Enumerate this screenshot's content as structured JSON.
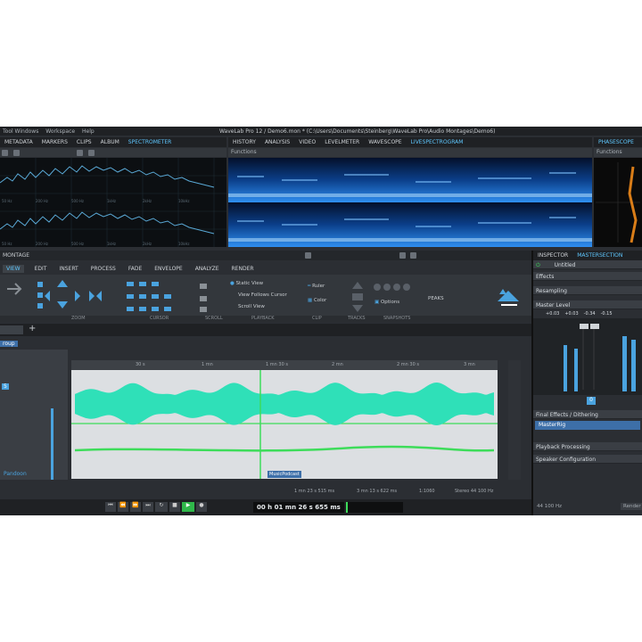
{
  "menu": {
    "items": [
      "Tool Windows",
      "Workspace",
      "Help"
    ],
    "title": "WaveLab Pro 12 / Demo6.mon * (C:\\Users\\Documents\\Steinberg\\WaveLab Pro\\Audio Montages\\Demo6)"
  },
  "left_tabs": [
    "METADATA",
    "MARKERS",
    "CLIPS",
    "ALBUM",
    "SPECTROMETER"
  ],
  "mid_tabs": [
    "HISTORY",
    "ANALYSIS",
    "VIDEO",
    "LEVELMETER",
    "WAVESCOPE",
    "LIVESPECTROGRAM"
  ],
  "right_tabs": [
    "PHASESCOPE"
  ],
  "functions_label": "Functions",
  "spectrum_ticks": [
    "50 Hz",
    "100 Hz",
    "200 Hz",
    "500 Hz",
    "1kHz",
    "2kHz",
    "5kHz",
    "10kHz",
    "20kHz"
  ],
  "montage_label": "MONTAGE",
  "ribbon_tabs": [
    "VIEW",
    "EDIT",
    "INSERT",
    "PROCESS",
    "FADE",
    "ENVELOPE",
    "ANALYZE",
    "RENDER"
  ],
  "ribbon_groups": [
    "ZOOM",
    "CURSOR",
    "SCROLL",
    "PLAYBACK",
    "CLIP",
    "TRACKS",
    "SNAPSHOTS"
  ],
  "playback_options": [
    "Static View",
    "View Follows Cursor",
    "Scroll View"
  ],
  "ruler_label": "Ruler",
  "color_label": "Color",
  "options_label": "Options",
  "peaks_label": "PEAKS",
  "track_group": "roup",
  "timeline_ticks": [
    "30 s",
    "1 mn",
    "1 mn 30 s",
    "2 mn",
    "2 mn 30 s",
    "3 mn",
    "3 mn 30 s"
  ],
  "clip_name": "MusicPodcast",
  "track_name": "Pandoon",
  "status": {
    "pos1": "1 mn 23 s 515 ms",
    "pos2": "3 mn 13 s 622 ms",
    "zoom": "1:1060",
    "format": "Stereo 44 100 Hz"
  },
  "transport_time": "00 h 01 mn 26 s 655 ms",
  "inspector": {
    "tab1": "INSPECTOR",
    "tab2": "MASTERSECTION",
    "preset": "Untitled",
    "effects": "Effects",
    "resampling": "Resampling",
    "master_level": "Master Level",
    "meter_values": [
      "+0.03",
      "+0.03",
      "-0.34",
      "-0.15"
    ],
    "final_effects": "Final Effects / Dithering",
    "masterrig": "MasterRig",
    "playback_processing": "Playback Processing",
    "speaker_config": "Speaker Configuration",
    "sample_rate": "44 100 Hz",
    "render": "Render",
    "level_value": "0"
  },
  "colors": {
    "accent": "#4aa3df",
    "wave": "#2fe0b8",
    "wave_green": "#3ddc5a",
    "panel": "#2b2e33"
  }
}
